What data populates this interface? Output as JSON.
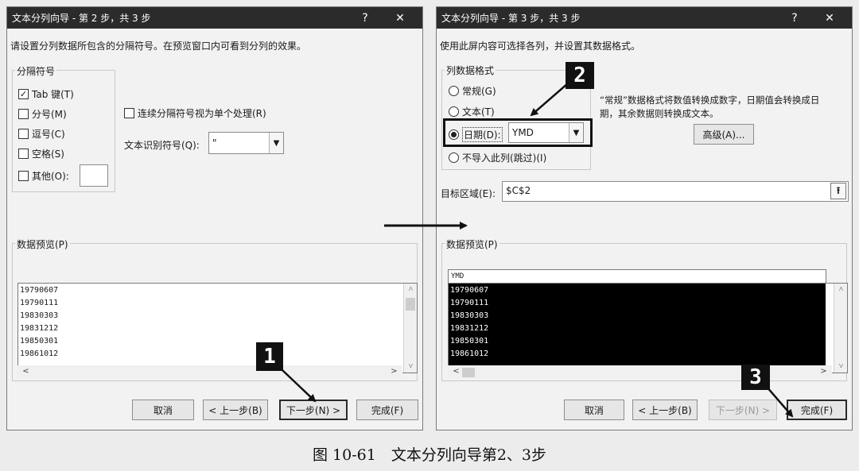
{
  "dialog1": {
    "title": "文本分列向导 - 第 2 步，共 3 步",
    "help": "?",
    "close": "✕",
    "instruction": "请设置分列数据所包含的分隔符号。在预览窗口内可看到分列的效果。",
    "delimiters_group": "分隔符号",
    "delimiters": [
      {
        "label": "Tab 键(T)",
        "checked": true
      },
      {
        "label": "分号(M)",
        "checked": false
      },
      {
        "label": "逗号(C)",
        "checked": false
      },
      {
        "label": "空格(S)",
        "checked": false
      },
      {
        "label": "其他(O):",
        "checked": false
      }
    ],
    "other_value": "",
    "consecutive_label": "连续分隔符号视为单个处理(R)",
    "qualifier_label": "文本识别符号(Q):",
    "qualifier_value": "\"",
    "preview_label": "数据预览(P)",
    "preview_rows": [
      "19790607",
      "19790111",
      "19830303",
      "19831212",
      "19850301",
      "19861012"
    ],
    "buttons": {
      "cancel": "取消",
      "back": "< 上一步(B)",
      "next": "下一步(N) >",
      "finish": "完成(F)"
    }
  },
  "dialog2": {
    "title": "文本分列向导 - 第 3 步，共 3 步",
    "help": "?",
    "close": "✕",
    "instruction": "使用此屏内容可选择各列，并设置其数据格式。",
    "format_group": "列数据格式",
    "formats": [
      {
        "label": "常规(G)",
        "selected": false
      },
      {
        "label": "文本(T)",
        "selected": false
      },
      {
        "label": "日期(D):",
        "selected": true
      },
      {
        "label": "不导入此列(跳过)(I)",
        "selected": false
      }
    ],
    "date_value": "YMD",
    "description_line1": "“常规”数据格式将数值转换成数字，日期值会转换成日",
    "description_line2": "期，其余数据则转换成文本。",
    "advanced_button": "高级(A)...",
    "destination_label": "目标区域(E):",
    "destination_value": "$C$2",
    "preview_label": "数据预览(P)",
    "preview_header": "YMD",
    "preview_rows": [
      "19790607",
      "19790111",
      "19830303",
      "19831212",
      "19850301",
      "19861012"
    ],
    "buttons": {
      "cancel": "取消",
      "back": "< 上一步(B)",
      "next": "下一步(N) >",
      "finish": "完成(F)"
    }
  },
  "badges": {
    "one": "1",
    "two": "2",
    "three": "3"
  },
  "caption": "图 10-61　文本分列向导第2、3步"
}
